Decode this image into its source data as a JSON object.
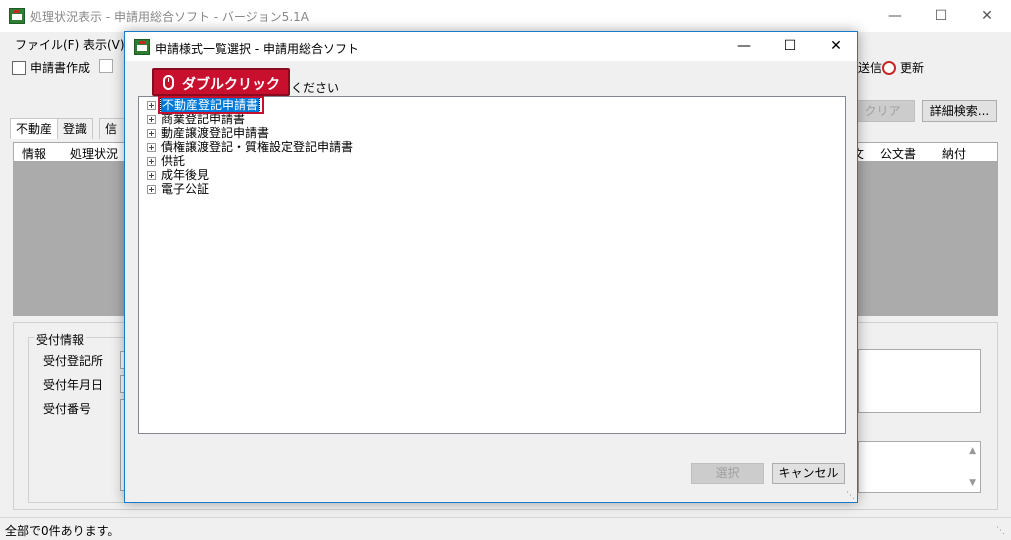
{
  "main_window": {
    "title": "処理状況表示 - 申請用総合ソフト - バージョン5.1A",
    "menu": [
      "ファイル(F)",
      "表示(V)"
    ],
    "toolbar": {
      "create_label": "申請書作成",
      "send_label": "送信",
      "refresh_label": "更新"
    },
    "buttons": {
      "clear_label": "クリア",
      "detail_search_label": "詳細検索..."
    },
    "tabs": [
      "不動産",
      "登識",
      "信託"
    ],
    "grid_headers_left": [
      "情報",
      "処理状況"
    ],
    "grid_headers_right": [
      "文",
      "公文書",
      "納付"
    ],
    "reception": {
      "group_label": "受付情報",
      "office_label": "受付登記所",
      "date_label": "受付年月日",
      "number_label": "受付番号"
    },
    "status": "全部で0件あります。"
  },
  "dialog": {
    "title": "申請様式一覧選択 - 申請用総合ソフト",
    "instruction_tail": "ください",
    "tree_items": [
      "不動産登記申請書",
      "商業登記申請書",
      "動産譲渡登記申請書",
      "債権譲渡登記・質権設定登記申請書",
      "供託",
      "成年後見",
      "電子公証"
    ],
    "selected_index": 0,
    "select_button": "選択",
    "cancel_button": "キャンセル"
  },
  "callout": {
    "text": "ダブルクリック",
    "color": "#c8102e"
  },
  "colors": {
    "accent": "#0078d7",
    "dialog_border": "#1979ca"
  }
}
